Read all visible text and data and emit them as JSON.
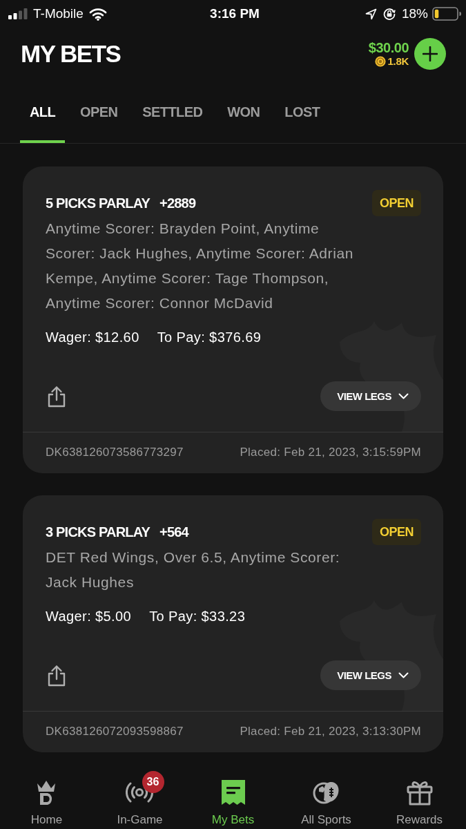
{
  "status_bar": {
    "carrier": "T-Mobile",
    "time": "3:16 PM",
    "battery": "18%"
  },
  "header": {
    "title": "MY BETS",
    "balance": "$30.00",
    "coins": "1.8K"
  },
  "tabs": [
    {
      "label": "ALL",
      "selected": true
    },
    {
      "label": "OPEN",
      "selected": false
    },
    {
      "label": "SETTLED",
      "selected": false
    },
    {
      "label": "WON",
      "selected": false
    },
    {
      "label": "LOST",
      "selected": false
    }
  ],
  "bets": [
    {
      "title": "5 PICKS PARLAY",
      "odds": "+2889",
      "status": "OPEN",
      "legs": "Anytime Scorer: Brayden Point, Anytime Scorer: Jack Hughes, Anytime Scorer: Adrian Kempe, Anytime Scorer: Tage Thompson, Anytime Scorer: Connor McDavid",
      "wager": "Wager: $12.60",
      "to_pay": "To Pay: $376.69",
      "button": "VIEW LEGS",
      "bet_id": "DK638126073586773297",
      "placed": "Placed: Feb 21, 2023, 3:15:59PM"
    },
    {
      "title": "3 PICKS PARLAY",
      "odds": "+564",
      "status": "OPEN",
      "legs": "DET Red Wings, Over 6.5, Anytime Scorer: Jack Hughes",
      "wager": "Wager: $5.00",
      "to_pay": "To Pay: $33.23",
      "button": "VIEW LEGS",
      "bet_id": "DK638126072093598867",
      "placed": "Placed: Feb 21, 2023, 3:13:30PM"
    }
  ],
  "bottom_nav": [
    {
      "kind": "home",
      "label": "Home",
      "selected": false
    },
    {
      "kind": "live",
      "label": "In-Game",
      "selected": false,
      "badge": "36"
    },
    {
      "kind": "bets",
      "label": "My Bets",
      "selected": true
    },
    {
      "kind": "sports",
      "label": "All Sports",
      "selected": false
    },
    {
      "kind": "rewards",
      "label": "Rewards",
      "selected": false
    }
  ]
}
